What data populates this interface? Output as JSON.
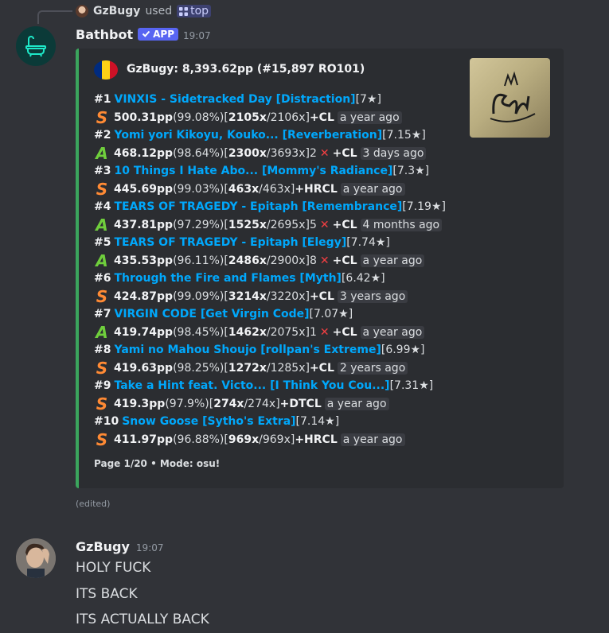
{
  "reply": {
    "user": "GzBugy",
    "verb": "used",
    "command": "top"
  },
  "bot": {
    "name": "Bathbot",
    "badge": "APP",
    "time": "19:07"
  },
  "embed": {
    "accent": "#3ba55d",
    "author": "GzBugy: 8,393.62pp (#15,897 RO101)",
    "flag_colors": [
      "#002b7f",
      "#fcd116",
      "#ce1126"
    ],
    "footer": "Page 1/20 • Mode: osu!",
    "scores": [
      {
        "rank": "#1",
        "map": "VINXIS - Sidetracked Day [Distraction]",
        "stars": "[7★]",
        "grade": "S",
        "pp": "500.31pp",
        "acc": "(99.08%)",
        "combo": "2105x",
        "max": "/2106x]",
        "misses": "",
        "mods": "+CL",
        "ago": "a year ago"
      },
      {
        "rank": "#2",
        "map": "Yomi yori Kikoyu, Kouko... [Reverberation]",
        "stars": "[7.15★]",
        "grade": "A",
        "pp": "468.12pp",
        "acc": "(98.64%)",
        "combo": "2300x",
        "max": "/3693x]",
        "misses": "2",
        "mods": "+CL",
        "ago": "3 days ago"
      },
      {
        "rank": "#3",
        "map": "10 Things I Hate Abo... [Mommy's Radiance]",
        "stars": "[7.3★]",
        "grade": "S",
        "pp": "445.69pp",
        "acc": "(99.03%)",
        "combo": "463x",
        "max": "/463x]",
        "misses": "",
        "mods": "+HRCL",
        "ago": "a year ago"
      },
      {
        "rank": "#4",
        "map": "TEARS OF TRAGEDY - Epitaph [Remembrance]",
        "stars": "[7.19★]",
        "grade": "A",
        "pp": "437.81pp",
        "acc": "(97.29%)",
        "combo": "1525x",
        "max": "/2695x]",
        "misses": "5",
        "mods": "+CL",
        "ago": "4 months ago"
      },
      {
        "rank": "#5",
        "map": "TEARS OF TRAGEDY - Epitaph [Elegy]",
        "stars": "[7.74★]",
        "grade": "A",
        "pp": "435.53pp",
        "acc": "(96.11%)",
        "combo": "2486x",
        "max": "/2900x]",
        "misses": "8",
        "mods": "+CL",
        "ago": "a year ago"
      },
      {
        "rank": "#6",
        "map": "Through the Fire and Flames [Myth]",
        "stars": "[6.42★]",
        "grade": "S",
        "pp": "424.87pp",
        "acc": "(99.09%)",
        "combo": "3214x",
        "max": "/3220x]",
        "misses": "",
        "mods": "+CL",
        "ago": "3 years ago"
      },
      {
        "rank": "#7",
        "map": "VIRGIN CODE [Get Virgin Code]",
        "stars": "[7.07★]",
        "grade": "A",
        "pp": "419.74pp",
        "acc": "(98.45%)",
        "combo": "1462x",
        "max": "/2075x]",
        "misses": "1",
        "mods": "+CL",
        "ago": "a year ago"
      },
      {
        "rank": "#8",
        "map": "Yami no Mahou Shoujo [rollpan's Extreme]",
        "stars": "[6.99★]",
        "grade": "S",
        "pp": "419.63pp",
        "acc": "(98.25%)",
        "combo": "1272x",
        "max": "/1285x]",
        "misses": "",
        "mods": "+CL",
        "ago": "2 years ago"
      },
      {
        "rank": "#9",
        "map": "Take a Hint feat. Victo... [I Think You Cou...]",
        "stars": "[7.31★]",
        "grade": "S",
        "pp": "419.3pp",
        "acc": "(97.9%)",
        "combo": "274x",
        "max": "/274x]",
        "misses": "",
        "mods": "+DTCL",
        "ago": "a year ago"
      },
      {
        "rank": "#10",
        "map": "Snow Goose [Sytho's Extra]",
        "stars": "[7.14★]",
        "grade": "S",
        "pp": "411.97pp",
        "acc": "(96.88%)",
        "combo": "969x",
        "max": "/969x]",
        "misses": "",
        "mods": "+HRCL",
        "ago": "a year ago"
      }
    ]
  },
  "edited": "(edited)",
  "user": {
    "name": "GzBugy",
    "time": "19:07"
  },
  "messages": [
    "HOLY FUCK",
    "ITS BACK",
    "ITS ACTUALLY BACK"
  ]
}
